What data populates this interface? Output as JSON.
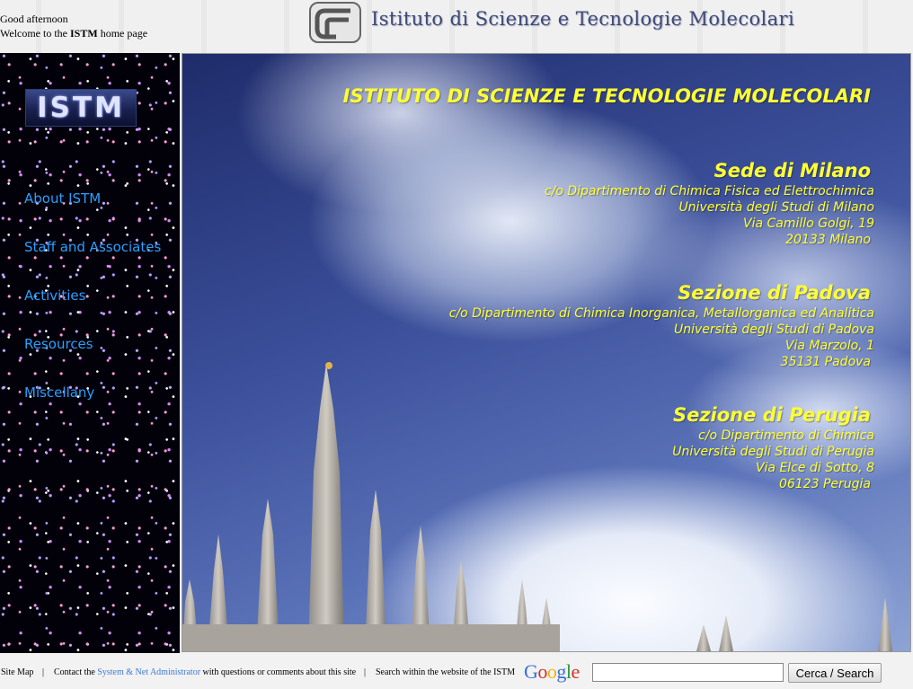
{
  "header": {
    "greeting": "Good afternoon",
    "welcome_prefix": "Welcome to the ",
    "welcome_bold": "ISTM",
    "welcome_suffix": " home page",
    "title": "Istituto di Scienze e Tecnologie Molecolari"
  },
  "sidebar": {
    "logo_text": "ISTM",
    "items": [
      {
        "label": "About ISTM"
      },
      {
        "label": "Staff and Associates"
      },
      {
        "label": "Activities"
      },
      {
        "label": "Resources"
      },
      {
        "label": "Miscellany"
      }
    ]
  },
  "main": {
    "title": "ISTITUTO DI SCIENZE E TECNOLOGIE MOLECOLARI",
    "sites": [
      {
        "name": "Sede di Milano",
        "lines": [
          "c/o Dipartimento di Chimica Fisica ed Elettrochimica",
          "Università degli Studi di Milano",
          "Via Camillo Golgi, 19",
          "20133 Milano"
        ]
      },
      {
        "name": "Sezione di Padova",
        "lines": [
          "c/o Dipartimento di Chimica Inorganica, Metallorganica ed Analitica",
          "Università degli Studi di Padova",
          "Via Marzolo, 1",
          "35131 Padova"
        ]
      },
      {
        "name": "Sezione di Perugia",
        "lines": [
          "c/o Dipartimento di Chimica",
          "Università degli Studi di Perugia",
          "Via Elce di Sotto, 8",
          "06123 Perugia"
        ]
      }
    ]
  },
  "footer": {
    "site_map": "Site Map",
    "separator": "|",
    "contact_prefix": "Contact the ",
    "contact_link": "System & Net Administrator",
    "contact_suffix": " with questions or comments about this site",
    "search_label": "Search within the website of the ISTM",
    "google_letters": [
      "G",
      "o",
      "o",
      "g",
      "l",
      "e"
    ],
    "google_colors": [
      "#3b6fd6",
      "#d6302b",
      "#f1b500",
      "#3b6fd6",
      "#2b9a3a",
      "#d6302b"
    ],
    "search_value": "",
    "search_button": "Cerca / Search"
  },
  "colors": {
    "accent_yellow": "#ffff33",
    "nav_link": "#2aa0ff",
    "footer_link": "#3b7bd6"
  }
}
